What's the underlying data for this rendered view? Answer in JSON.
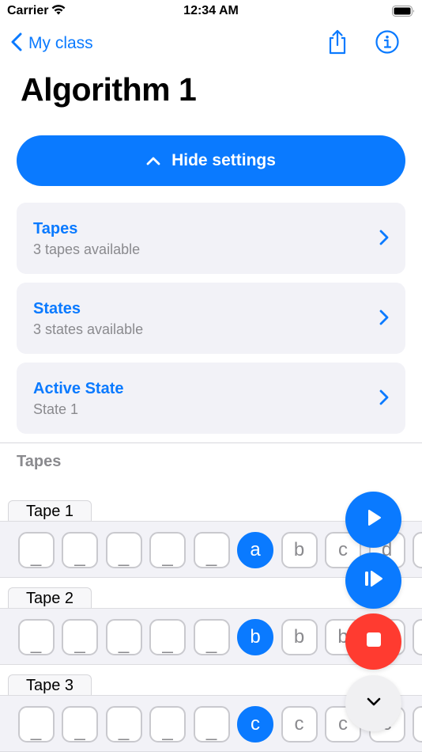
{
  "status_bar": {
    "carrier": "Carrier",
    "time": "12:34 AM"
  },
  "nav": {
    "back_label": "My class",
    "share_icon": "share-icon",
    "info_icon": "info-icon"
  },
  "title": "Algorithm 1",
  "settings_button": {
    "label": "Hide settings",
    "icon": "chevron-up-icon"
  },
  "settings": [
    {
      "title": "Tapes",
      "subtitle": "3 tapes available"
    },
    {
      "title": "States",
      "subtitle": "3 states available"
    },
    {
      "title": "Active State",
      "subtitle": "State 1"
    }
  ],
  "tapes_section_title": "Tapes",
  "tapes": [
    {
      "label": "Tape 1",
      "cells": [
        "_",
        "_",
        "_",
        "_",
        "_",
        "a",
        "b",
        "c",
        "d",
        "",
        ""
      ],
      "active_index": 5
    },
    {
      "label": "Tape 2",
      "cells": [
        "_",
        "_",
        "_",
        "_",
        "_",
        "b",
        "b",
        "b",
        "",
        "",
        ""
      ],
      "active_index": 5
    },
    {
      "label": "Tape 3",
      "cells": [
        "_",
        "_",
        "_",
        "_",
        "_",
        "c",
        "c",
        "c",
        "c",
        "",
        ""
      ],
      "active_index": 5
    }
  ],
  "controls": [
    {
      "name": "play-button",
      "icon": "play-icon",
      "color": "#0a7aff"
    },
    {
      "name": "step-button",
      "icon": "step-forward-icon",
      "color": "#0a7aff"
    },
    {
      "name": "stop-button",
      "icon": "stop-icon",
      "color": "#ff3b30"
    },
    {
      "name": "collapse-button",
      "icon": "chevron-down-icon",
      "color": "#f0f0f2"
    }
  ],
  "colors": {
    "accent": "#0a7aff",
    "stop": "#ff3b30",
    "secondary_text": "#8a8a8e",
    "card_bg": "#f2f2f7"
  }
}
